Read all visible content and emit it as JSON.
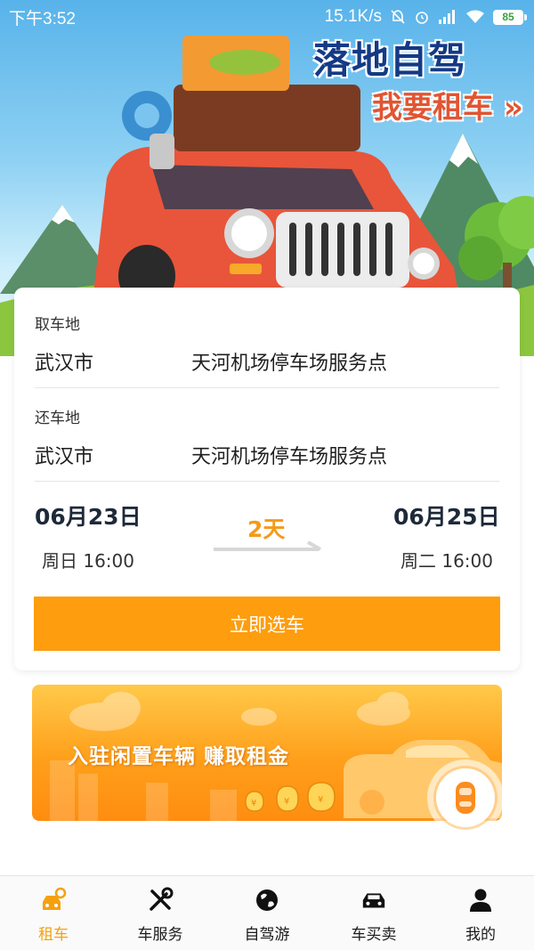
{
  "status_bar": {
    "time": "下午3:52",
    "net_speed": "15.1K/s",
    "battery": "85"
  },
  "banner": {
    "title": "落地自驾",
    "subtitle": "我要租车 »"
  },
  "booking": {
    "pickup_label": "取车地",
    "pickup_city": "武汉市",
    "pickup_location": "天河机场停车场服务点",
    "return_label": "还车地",
    "return_city": "武汉市",
    "return_location": "天河机场停车场服务点",
    "start_date": "06月23日",
    "start_time": "周日 16:00",
    "duration": "2天",
    "end_date": "06月25日",
    "end_time": "周二 16:00",
    "submit_label": "立即选车"
  },
  "earn_banner": {
    "text": "入驻闲置车辆  赚取租金"
  },
  "nav": {
    "items": [
      {
        "label": "租车",
        "icon": "car-key-icon",
        "active": true
      },
      {
        "label": "车服务",
        "icon": "tools-icon",
        "active": false
      },
      {
        "label": "自驾游",
        "icon": "globe-icon",
        "active": false
      },
      {
        "label": "车买卖",
        "icon": "car-icon",
        "active": false
      },
      {
        "label": "我的",
        "icon": "person-icon",
        "active": false
      }
    ]
  },
  "colors": {
    "accent": "#fe9d0e",
    "duration": "#f59a17",
    "nav_active": "#f5a10f",
    "title_blue": "#143a86",
    "subtitle_red": "#e25532"
  }
}
